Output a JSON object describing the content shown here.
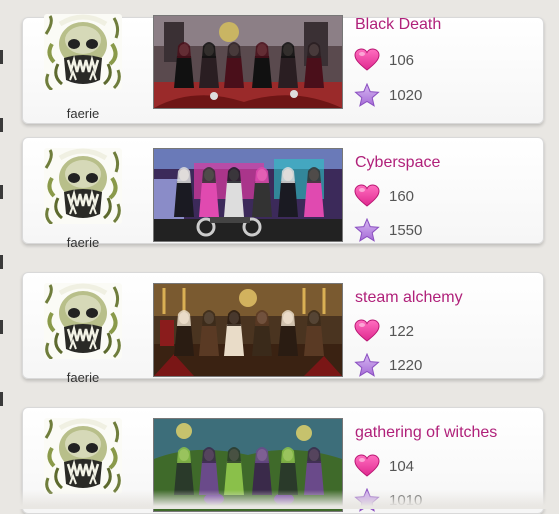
{
  "items": [
    {
      "title": "Black Death",
      "owner": "faerie",
      "likes": "106",
      "favorites": "1020",
      "scene": "dark"
    },
    {
      "title": "Cyberspace",
      "owner": "faerie",
      "likes": "160",
      "favorites": "1550",
      "scene": "cyber"
    },
    {
      "title": "steam alchemy",
      "owner": "faerie",
      "likes": "122",
      "favorites": "1220",
      "scene": "steam"
    },
    {
      "title": "gathering of witches",
      "owner": "faerie",
      "likes": "104",
      "favorites": "1010",
      "scene": "witch"
    }
  ],
  "colors": {
    "title": "#b0217a",
    "heart": "#e0288f",
    "star": "#a56bd6"
  },
  "icons": {
    "likes": "heart-icon",
    "favorites": "star-icon"
  }
}
